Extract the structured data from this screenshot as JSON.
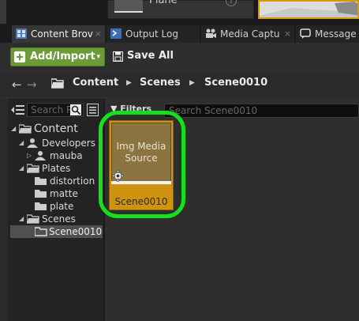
{
  "top": {
    "plane_label": "Plane",
    "help_glyph": "?"
  },
  "tabs": [
    {
      "label": "Content Brov",
      "icon": "content-browser-icon",
      "active": true,
      "close": "×"
    },
    {
      "label": "Output Log",
      "icon": "output-log-icon",
      "active": false,
      "close": ""
    },
    {
      "label": "Media Captu",
      "icon": "media-capture-icon",
      "active": false,
      "close": "×"
    },
    {
      "label": "Message",
      "icon": "message-icon",
      "active": false,
      "close": ""
    }
  ],
  "toolbar": {
    "add_import_label": "Add/Import",
    "add_import_caret": "▾",
    "save_all_label": "Save All",
    "accent": "#6d9b3c"
  },
  "path": {
    "back": "←",
    "forward": "→",
    "crumbs": [
      "Content",
      "Scenes",
      "Scene0010"
    ],
    "sep": "▶"
  },
  "tree": {
    "search_placeholder": "Search P",
    "items": [
      {
        "label": "Content",
        "arrow": "◢",
        "icon": "folder-open-icon"
      },
      {
        "label": "Developers",
        "arrow": "◢",
        "icon": "user-icon"
      },
      {
        "label": "mauba",
        "arrow": "▷",
        "icon": "user-icon"
      },
      {
        "label": "Plates",
        "arrow": "◢",
        "icon": "folder-open-icon"
      },
      {
        "label": "distortion",
        "arrow": "",
        "icon": "folder-icon"
      },
      {
        "label": "matte",
        "arrow": "",
        "icon": "folder-icon"
      },
      {
        "label": "plate",
        "arrow": "",
        "icon": "folder-icon"
      },
      {
        "label": "Scenes",
        "arrow": "◢",
        "icon": "folder-open-icon"
      },
      {
        "label": "Scene0010",
        "arrow": "",
        "icon": "folder-icon",
        "selected": true
      }
    ]
  },
  "content": {
    "filters_label": "▼ Filters",
    "search_placeholder": "Search Scene0010",
    "asset": {
      "type_label": "Img Media Source",
      "name": "Scene0010",
      "tile_color": "#d0930f"
    },
    "highlight_color": "#16e01c"
  }
}
